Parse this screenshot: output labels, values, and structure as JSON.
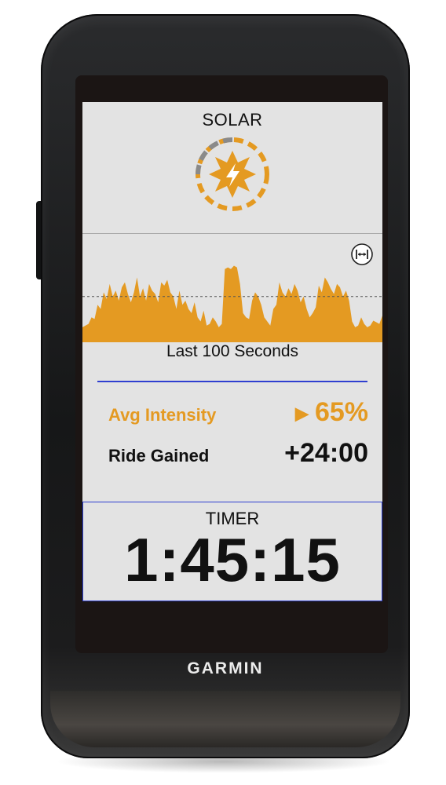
{
  "device": {
    "brand": "GARMIN"
  },
  "screen": {
    "title": "SOLAR",
    "icon": "sun-icon",
    "chart_label": "Last 100 Seconds",
    "zoom_icon": "fit-width-icon",
    "avg_intensity": {
      "label": "Avg Intensity",
      "value": "65%",
      "indicator": "▶"
    },
    "ride_gained": {
      "label": "Ride Gained",
      "value": "+24:00"
    },
    "timer": {
      "label": "TIMER",
      "value": "1:45:15"
    }
  },
  "colors": {
    "accent": "#e49a22",
    "divider": "#2f3fd0",
    "screen_bg": "#e3e3e3"
  },
  "chart_data": {
    "type": "area",
    "title": "Last 100 Seconds",
    "x_range": [
      0,
      100
    ],
    "y_range": [
      0,
      100
    ],
    "reference_line": 55,
    "values": [
      18,
      20,
      22,
      30,
      28,
      45,
      40,
      60,
      52,
      70,
      55,
      62,
      50,
      66,
      72,
      58,
      48,
      60,
      78,
      55,
      65,
      50,
      70,
      62,
      58,
      48,
      72,
      68,
      75,
      60,
      55,
      40,
      62,
      45,
      50,
      40,
      35,
      48,
      30,
      25,
      38,
      20,
      22,
      30,
      25,
      18,
      22,
      88,
      90,
      88,
      92,
      90,
      70,
      35,
      30,
      28,
      50,
      60,
      55,
      45,
      30,
      25,
      20,
      40,
      45,
      72,
      60,
      55,
      65,
      58,
      70,
      62,
      48,
      55,
      40,
      30,
      35,
      42,
      68,
      60,
      78,
      72,
      64,
      58,
      70,
      66,
      55,
      62,
      50,
      25,
      18,
      20,
      30,
      22,
      18,
      20,
      26,
      24,
      22,
      32
    ]
  }
}
